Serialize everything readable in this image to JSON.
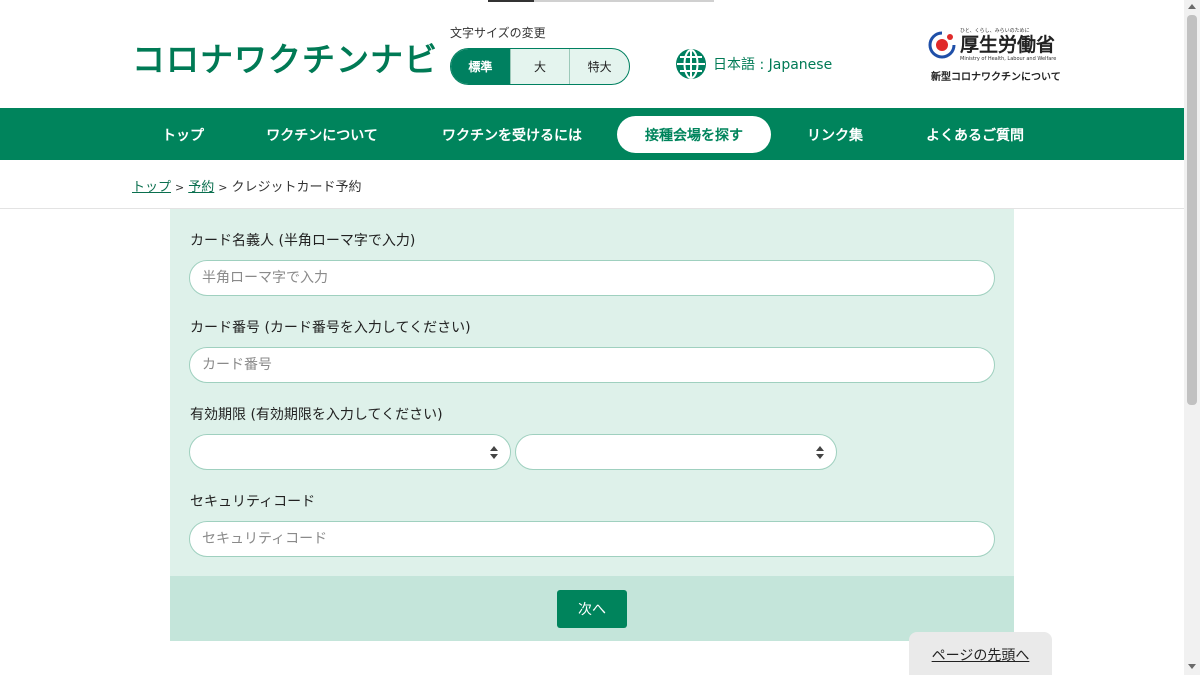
{
  "header": {
    "logo": "コロナワクチンナビ",
    "font_size": {
      "label": "文字サイズの変更",
      "options": [
        "標準",
        "大",
        "特大"
      ],
      "selected": "標準"
    },
    "language": {
      "label": "日本語 : Japanese",
      "icon": "globe-icon"
    },
    "ministry": {
      "tagline": "ひと、くらし、みらいのために",
      "name": "厚生労働省",
      "english": "Ministry of Health, Labour and Welfare",
      "link": "新型コロナワクチンについて",
      "icon": "mhlw-logo-icon"
    }
  },
  "nav": {
    "items": [
      "トップ",
      "ワクチンについて",
      "ワクチンを受けるには",
      "接種会場を探す",
      "リンク集",
      "よくあるご質問"
    ],
    "active": "接種会場を探す"
  },
  "breadcrumb": {
    "items": [
      "トップ",
      "予約"
    ],
    "current": "クレジットカード予約",
    "separator": ">"
  },
  "form": {
    "card_name": {
      "label": "カード名義人 (半角ローマ字で入力)",
      "placeholder": "半角ローマ字で入力",
      "value": ""
    },
    "card_number": {
      "label": "カード番号 (カード番号を入力してください)",
      "placeholder": "カード番号",
      "value": ""
    },
    "expiry": {
      "label": "有効期限 (有効期限を入力してください)",
      "month_value": "",
      "year_value": ""
    },
    "security_code": {
      "label": "セキュリティコード",
      "placeholder": "セキュリティコード",
      "value": ""
    },
    "next_button": "次へ"
  },
  "page_top": "ページの先頭へ",
  "colors": {
    "brand": "#00845c",
    "form_background": "#def1ea",
    "form_footer": "#c4e5da"
  }
}
